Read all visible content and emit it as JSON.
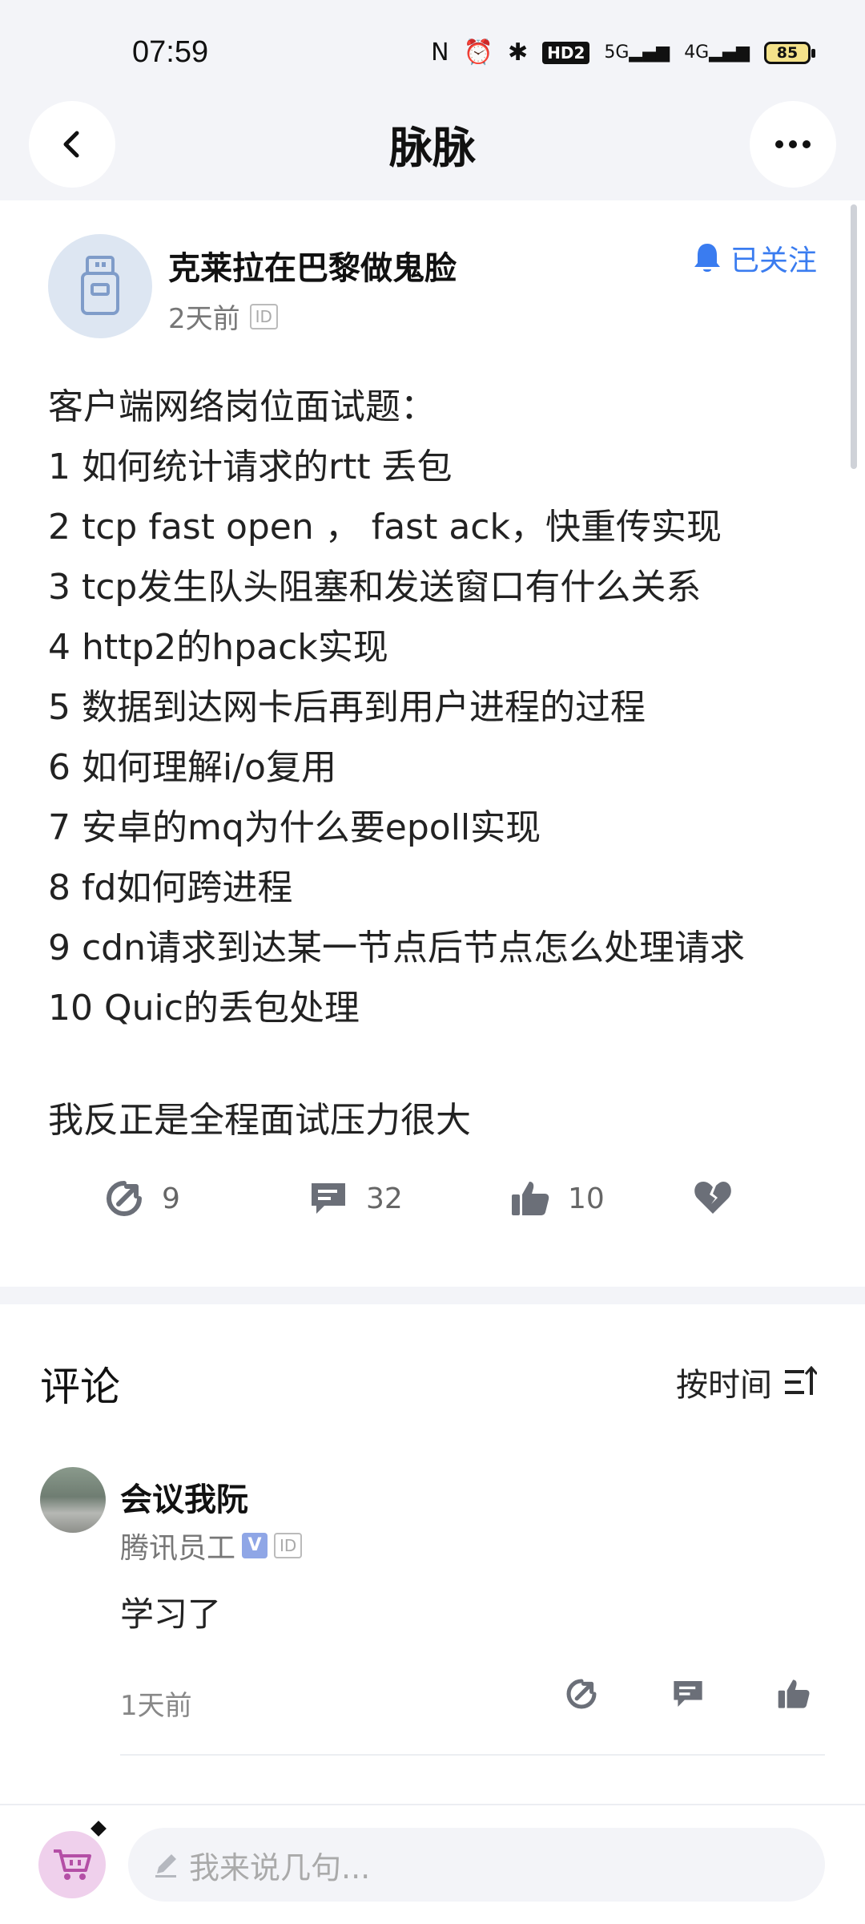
{
  "status_bar": {
    "time": "07:59",
    "network_labels": [
      "5G",
      "4G"
    ],
    "hd_label": "HD2",
    "battery": "85"
  },
  "nav": {
    "title": "脉脉",
    "back_icon": "chevron-left-icon",
    "more_icon": "more-horizontal-icon"
  },
  "post": {
    "author": "克莱拉在巴黎做鬼脸",
    "time": "2天前",
    "id_badge": "ID",
    "follow_label": "已关注",
    "lines": [
      "客户端网络岗位面试题：",
      "1 如何统计请求的rtt 丢包",
      "2 tcp fast open ， fast ack，快重传实现",
      "3 tcp发生队头阻塞和发送窗口有什么关系",
      "4 http2的hpack实现",
      "5 数据到达网卡后再到用户进程的过程",
      "6 如何理解i/o复用",
      "7 安卓的mq为什么要epoll实现",
      "8 fd如何跨进程",
      "9 cdn请求到达某一节点后节点怎么处理请求",
      "10 Quic的丢包处理"
    ],
    "closing": "我反正是全程面试压力很大",
    "actions": {
      "share_count": "9",
      "comment_count": "32",
      "like_count": "10"
    }
  },
  "comments": {
    "title": "评论",
    "sort_label": "按时间",
    "items": [
      {
        "author": "会议我阮",
        "company": "腾讯员工",
        "verified": "V",
        "id_badge": "ID",
        "text": "学习了",
        "time": "1天前"
      }
    ]
  },
  "composer": {
    "placeholder": "我来说几句..."
  },
  "colors": {
    "accent": "#3a7cf0",
    "background": "#f3f4f8",
    "icon_gray": "#6b6f78"
  }
}
